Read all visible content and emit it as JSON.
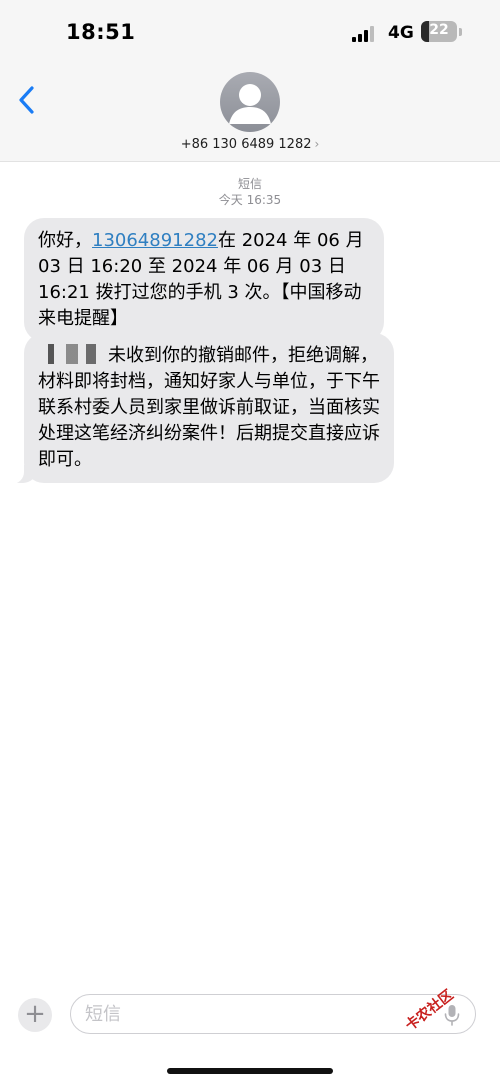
{
  "status_bar": {
    "time": "18:51",
    "network": "4G",
    "battery_percent": "22",
    "battery_fraction": 0.22
  },
  "contact": {
    "number": "+86 130 6489 1282",
    "chevron": "›"
  },
  "thread": {
    "service": "短信",
    "timestamp": "今天 16:35"
  },
  "messages": [
    {
      "prefix": "你好，",
      "link": "13064891282",
      "suffix": "在 2024 年 06 月 03 日 16:20 至 2024 年 06 月 03 日 16:21 拨打过您的手机 3 次。【中国移动 来电提醒】"
    },
    {
      "text": "未收到你的撤销邮件，拒绝调解，材料即将封档，通知好家人与单位，于下午联系村委人员到家里做诉前取证，当面核实处理这笔经济纠纷案件！后期提交直接应诉即可。"
    }
  ],
  "compose": {
    "placeholder": "短信",
    "plus": "+"
  },
  "watermark": "卡农社区",
  "icons": [
    "back-chevron-icon",
    "avatar-person-icon",
    "microphone-icon",
    "plus-icon"
  ],
  "colors": {
    "link": "#2f7fc1",
    "bubble": "#e9e9eb",
    "back_arrow": "#1a7cf5",
    "watermark": "#c8201e"
  }
}
